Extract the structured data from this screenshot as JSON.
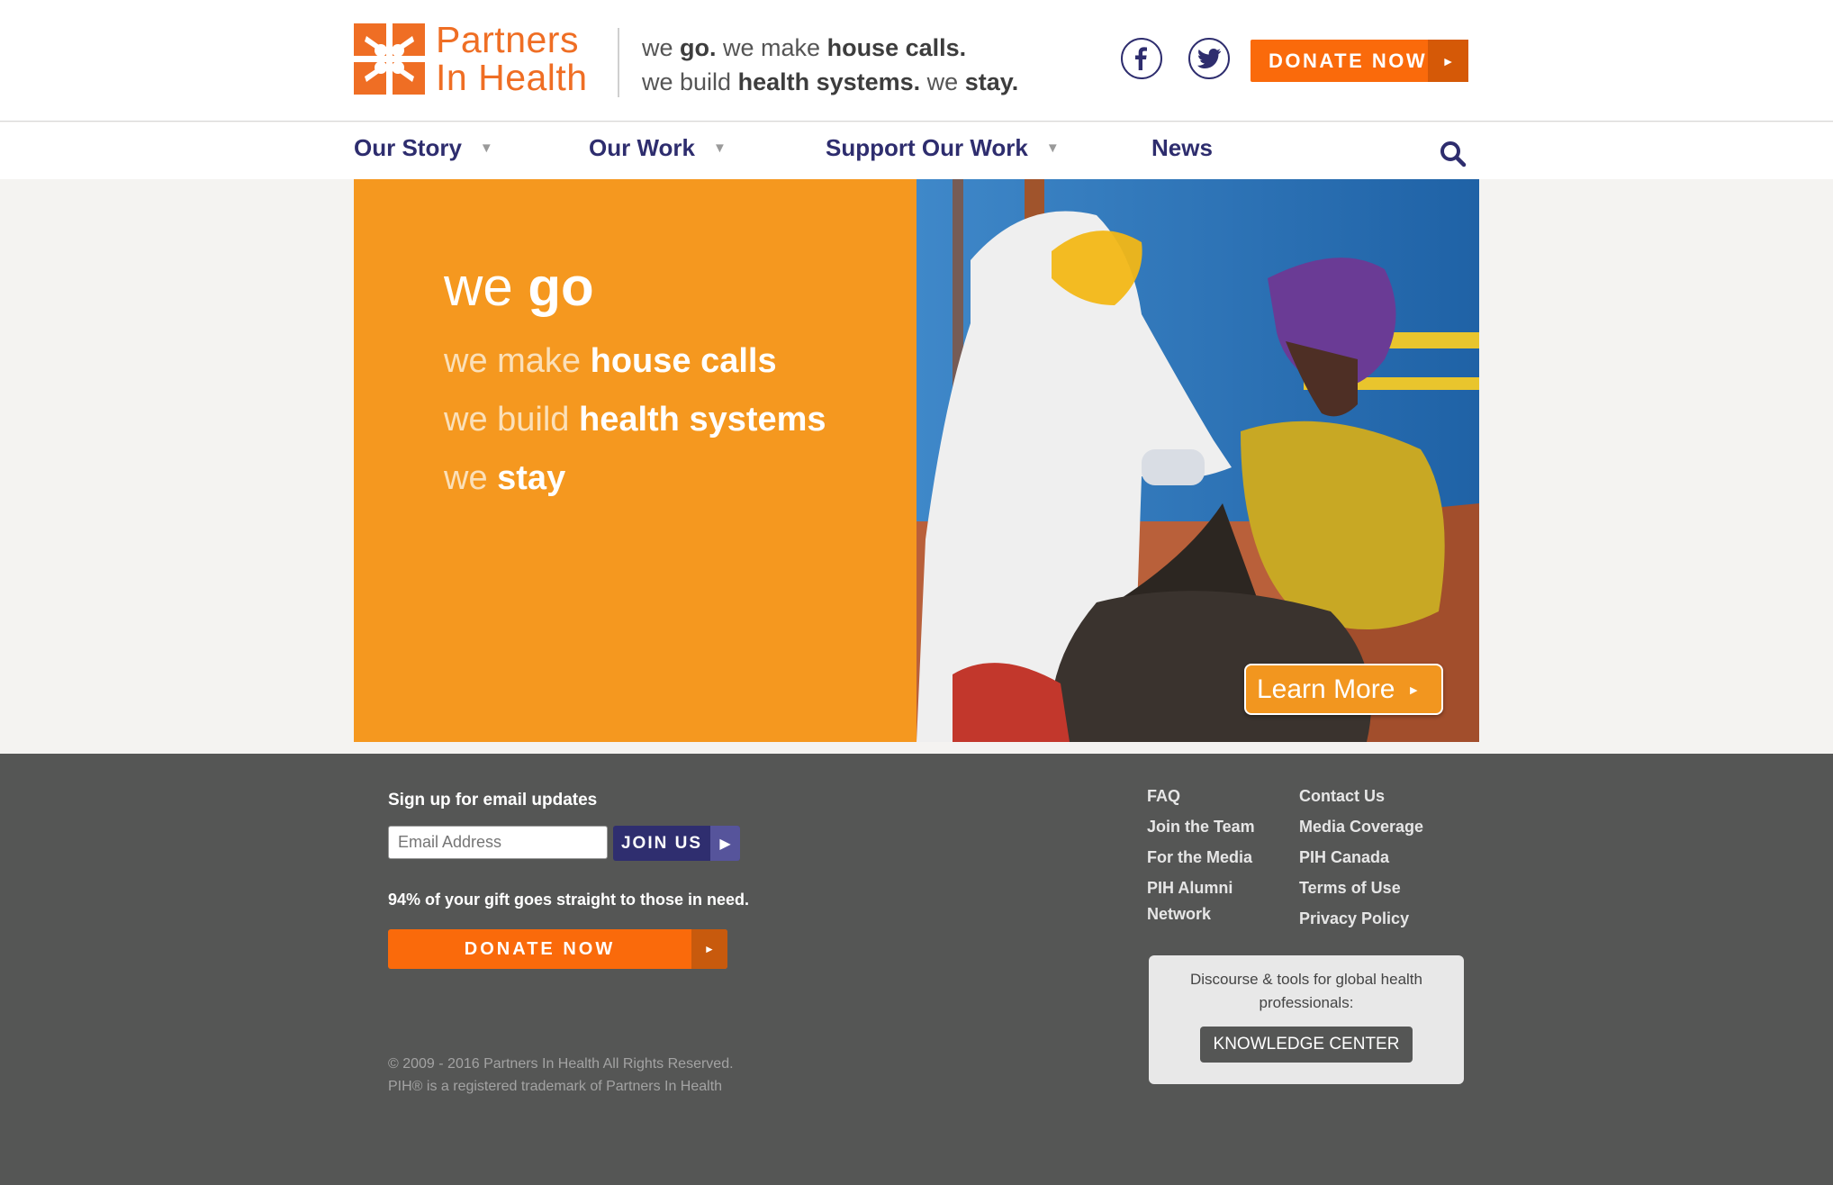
{
  "header": {
    "logo_line1": "Partners",
    "logo_line2": "In Health",
    "tagline": {
      "l1_a": "we ",
      "l1_b": "go.",
      "l1_c": " we make ",
      "l1_d": "house calls.",
      "l2_a": "we build ",
      "l2_b": "health systems.",
      "l2_c": " we ",
      "l2_d": "stay."
    },
    "social": [
      "facebook-icon",
      "twitter-icon"
    ],
    "donate_label": "DONATE NOW"
  },
  "nav": {
    "items": [
      {
        "label": "Our Story",
        "has_menu": true
      },
      {
        "label": "Our Work",
        "has_menu": true
      },
      {
        "label": "Support Our Work",
        "has_menu": true
      },
      {
        "label": "News",
        "has_menu": false
      }
    ],
    "search_icon": "search-icon"
  },
  "hero": {
    "line1_a": "we ",
    "line1_b": "go",
    "line2_a": "we make ",
    "line2_b": "house calls",
    "line3_a": "we build ",
    "line3_b": "health systems",
    "line4_a": "we ",
    "line4_b": "stay",
    "learn_more": "Learn More"
  },
  "footer": {
    "signup_heading": "Sign up for email updates",
    "email_placeholder": "Email Address",
    "join_label": "JOIN US",
    "gift_text": "94% of your gift goes straight to those in need.",
    "donate_label": "DONATE NOW",
    "copyright_l1": "© 2009 - 2016 Partners In Health All Rights Reserved.",
    "copyright_l2": "PIH® is a registered trademark of Partners In Health",
    "links_col1": [
      "FAQ",
      "Join the Team",
      "For the Media",
      "PIH Alumni Network"
    ],
    "links_col2": [
      "Contact Us",
      "Media Coverage",
      "PIH Canada",
      "Terms of Use",
      "Privacy Policy"
    ],
    "kc_text": "Discourse & tools for global health professionals:",
    "kc_button": "KNOWLEDGE CENTER"
  },
  "colors": {
    "brand_orange": "#ef6e24",
    "donate_orange": "#fa6a0b",
    "navy": "#2e2d6e",
    "hero_orange": "#f5981f",
    "footer_gray": "#555655"
  }
}
